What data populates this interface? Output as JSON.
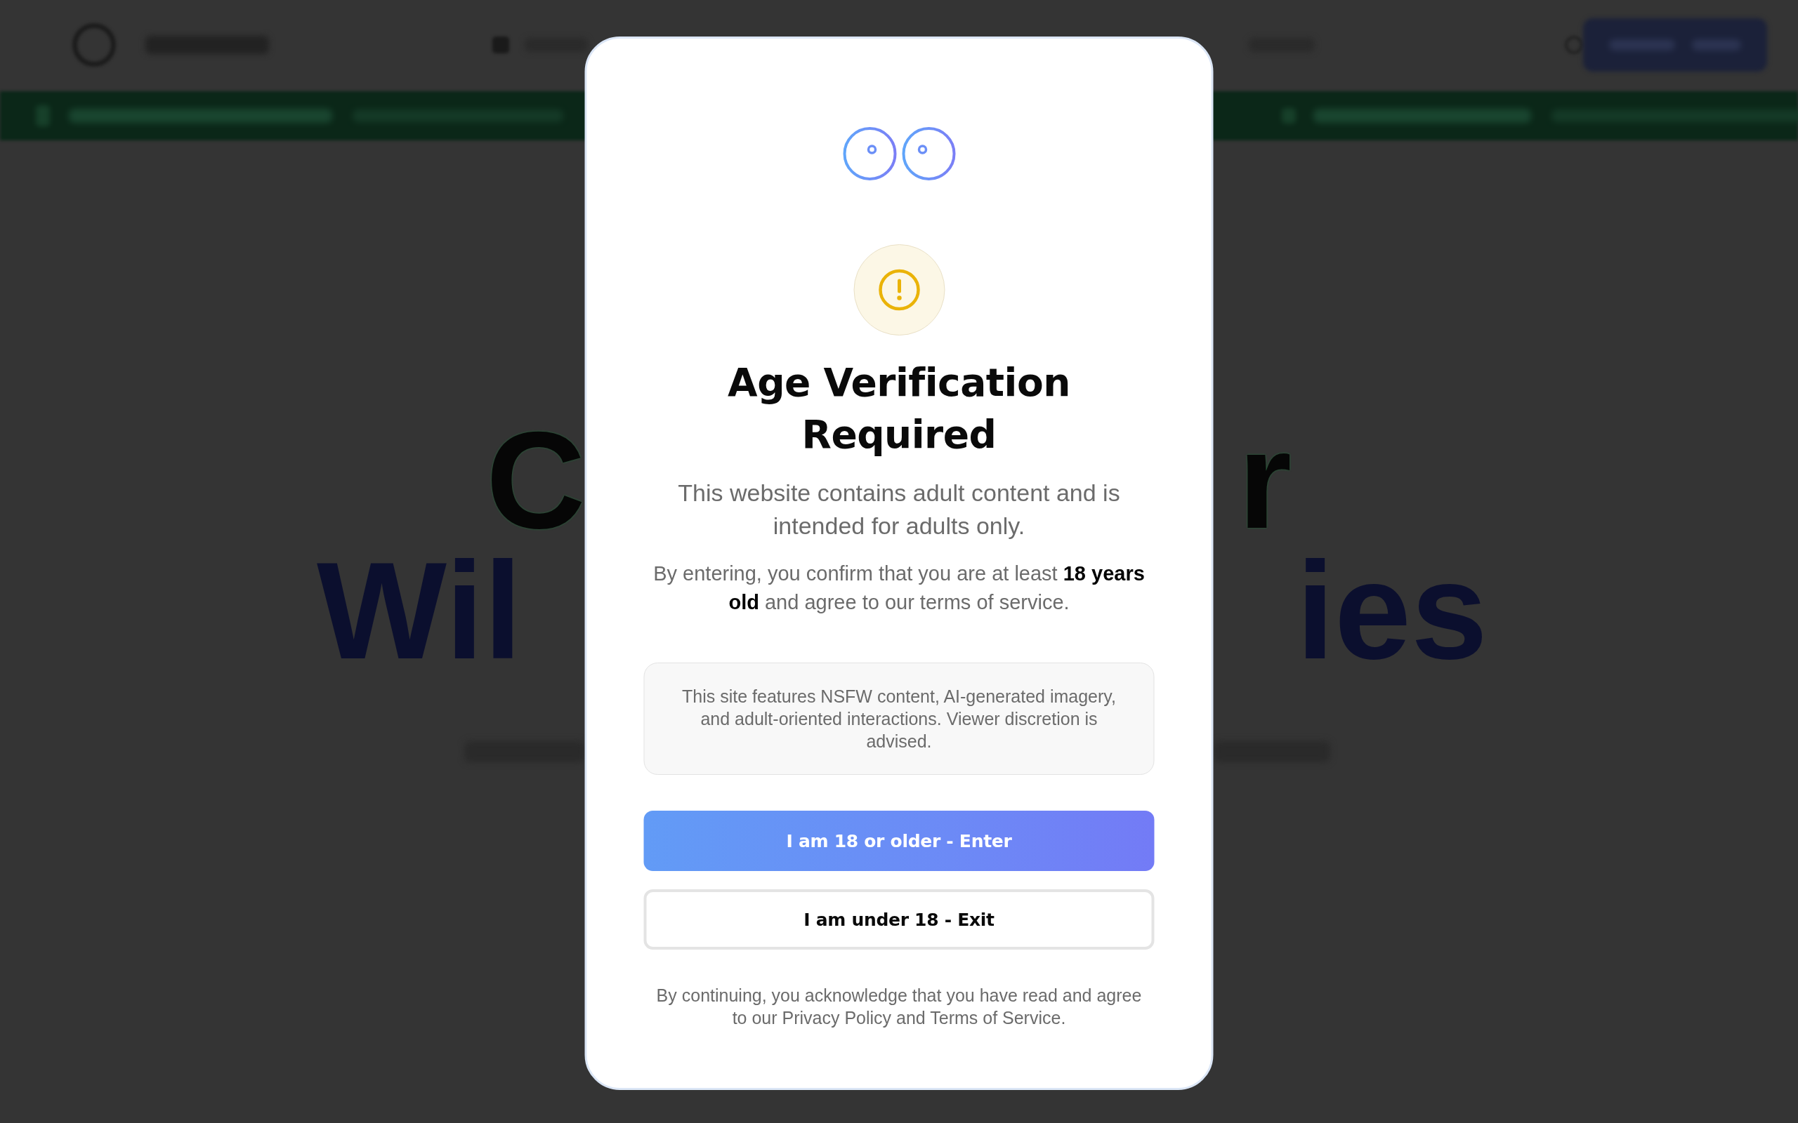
{
  "page": {
    "hero_title": [
      {
        "kind": "plain",
        "left": "C",
        "right": "r"
      },
      {
        "kind": "accent",
        "left": "Wil",
        "right": "ies"
      }
    ]
  },
  "dialog": {
    "title": "Age Verification Required",
    "intro": "This website contains adult content and is intended for adults only.",
    "confirmation": "By entering, you confirm that you are at least **18 years old** and agree to our terms of service.",
    "notice": "This site features NSFW content, AI-generated imagery, and adult-oriented interactions. Viewer discretion is advised.",
    "buttons": [
      {
        "kind": "primary",
        "label": "I am 18 or older - Enter"
      },
      {
        "kind": "secondary",
        "label": "I am under 18 - Exit"
      }
    ],
    "footer": "By continuing, you acknowledge that you have read and agree to our Privacy Policy and Terms of Service."
  }
}
